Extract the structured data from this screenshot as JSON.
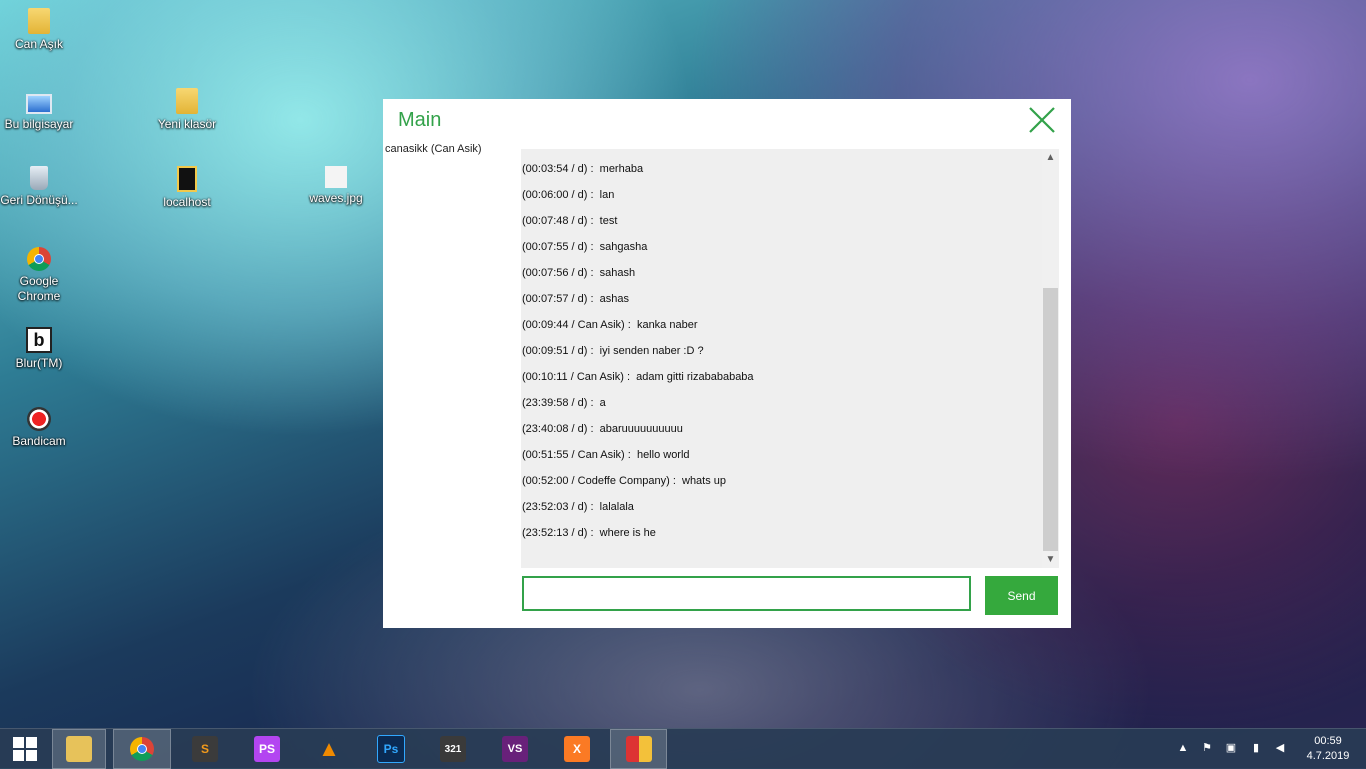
{
  "desktop": {
    "icons": [
      {
        "label": "Can Aşık",
        "icon": "user-folder-icon"
      },
      {
        "label": "Bu bilgisayar",
        "icon": "computer-icon"
      },
      {
        "label": "Yeni klasör",
        "icon": "folder-icon"
      },
      {
        "label": "Geri Dönüşü...",
        "icon": "recycle-bin-icon"
      },
      {
        "label": "localhost",
        "icon": "shortcut-icon"
      },
      {
        "label": "waves.jpg",
        "icon": "image-file-icon"
      },
      {
        "label": "Google Chrome",
        "icon": "chrome-icon"
      },
      {
        "label": "Blur(TM)",
        "icon": "blur-app-icon"
      },
      {
        "label": "Bandicam",
        "icon": "bandicam-icon"
      }
    ]
  },
  "window": {
    "title": "Main",
    "close_icon": "close-icon",
    "accent_color": "#33a24a",
    "online_users": [
      "canasikk  (Can Asik)"
    ],
    "messages": [
      "(00:03:54 / d) :  merhaba",
      "(00:06:00 / d) :  lan",
      "(00:07:48 / d) :  test",
      "(00:07:55 / d) :  sahgasha",
      "(00:07:56 / d) :  sahash",
      "(00:07:57 / d) :  ashas",
      "(00:09:44 / Can Asik) :  kanka naber",
      "(00:09:51 / d) :  iyi senden naber :D ?",
      "(00:10:11 / Can Asik) :  adam gitti rizababababa",
      "(23:39:58 / d) :  a",
      "(23:40:08 / d) :  abaruuuuuuuuuu",
      "(00:51:55 / Can Asik) :  hello world",
      "(00:52:00 / Codeffe Company) :  whats up",
      "(23:52:03 / d) :  lalalala",
      "(23:52:13 / d) :  where is he"
    ],
    "input_value": "",
    "send_label": "Send"
  },
  "taskbar": {
    "start_icon": "windows-start-icon",
    "apps": [
      {
        "name": "file-explorer",
        "icon": "file-explorer-icon",
        "glyph": "",
        "color": "#e7c25a"
      },
      {
        "name": "chrome",
        "icon": "chrome-icon",
        "glyph": "",
        "color": "#4285f4"
      },
      {
        "name": "sublime-text",
        "icon": "sublime-text-icon",
        "glyph": "S",
        "color": "#f39a1b"
      },
      {
        "name": "phpstorm",
        "icon": "phpstorm-icon",
        "glyph": "PS",
        "color": "#b345f1"
      },
      {
        "name": "vlc",
        "icon": "vlc-icon",
        "glyph": "▲",
        "color": "#f08a00"
      },
      {
        "name": "photoshop",
        "icon": "photoshop-icon",
        "glyph": "Ps",
        "color": "#0b2a52"
      },
      {
        "name": "media-player-classic",
        "icon": "media-player-icon",
        "glyph": "321",
        "color": "#3a3a3a"
      },
      {
        "name": "visual-studio",
        "icon": "visual-studio-icon",
        "glyph": "VS",
        "color": "#68217a"
      },
      {
        "name": "xampp",
        "icon": "xampp-icon",
        "glyph": "X",
        "color": "#fb7a24"
      },
      {
        "name": "winforms-app",
        "icon": "app-window-icon",
        "glyph": "",
        "color": "#d33"
      }
    ],
    "tray": {
      "icons": [
        "show-hidden-icons-icon",
        "flag-icon",
        "network-device-icon",
        "signal-icon",
        "volume-icon"
      ],
      "time": "00:59",
      "date": "4.7.2019"
    }
  }
}
